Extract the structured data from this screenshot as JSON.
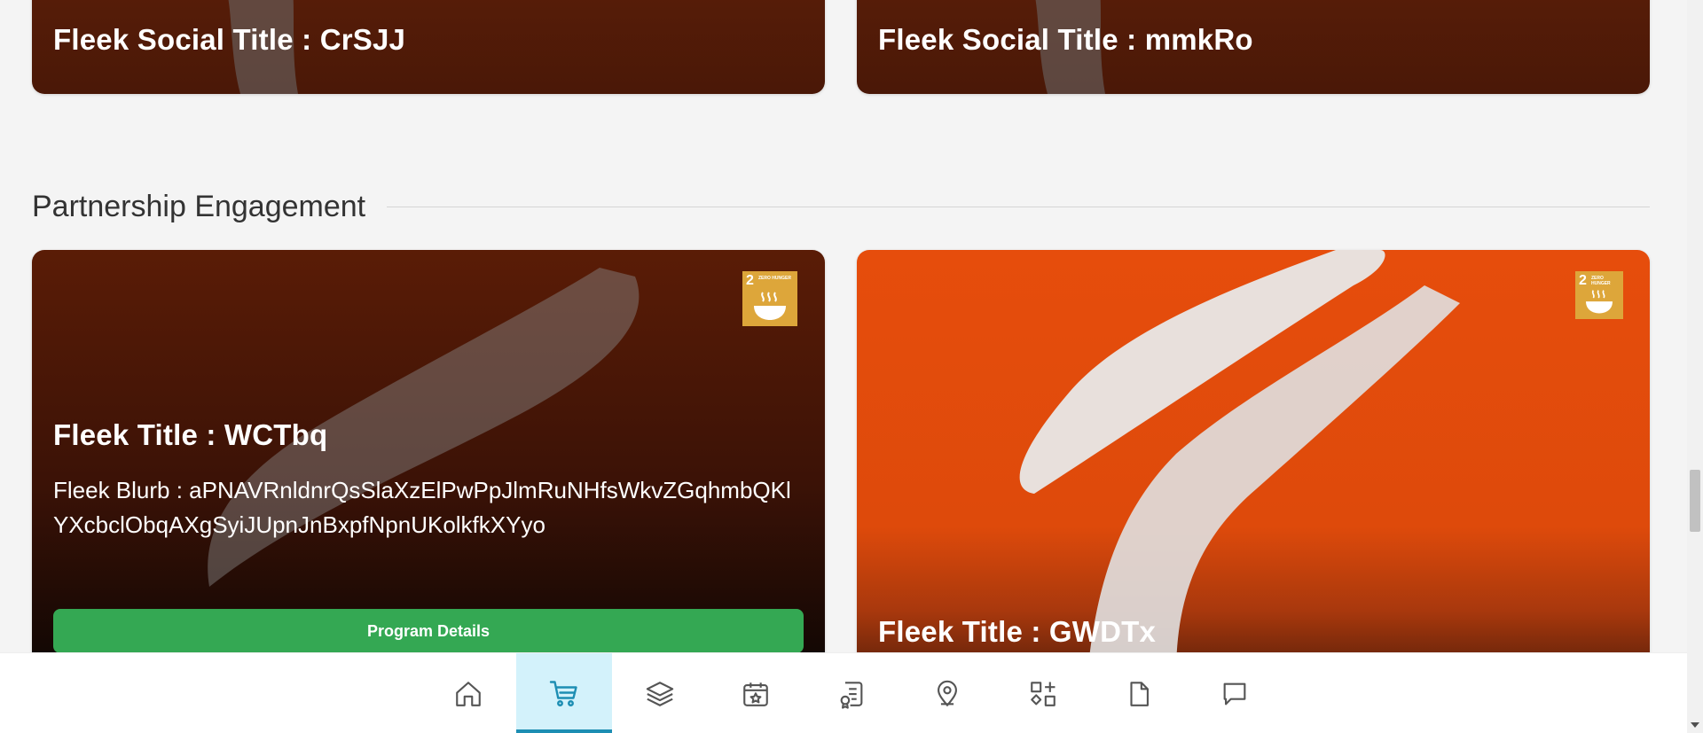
{
  "top_cards": [
    {
      "title": "Fleek Social Title : CrSJJ"
    },
    {
      "title": "Fleek Social Title : mmkRo"
    }
  ],
  "section": {
    "title": "Partnership Engagement"
  },
  "program_cards": [
    {
      "title": "Fleek Title : WCTbq",
      "blurb": "Fleek Blurb : aPNAVRnldnrQsSlaXzElPwPpJlmRuNHfsWkvZGqhmbQKlYXcbclObqAXgSyiJUpnJnBxpfNpnUKolkfkXYyo",
      "button_label": "Program Details",
      "badge": {
        "number": "2",
        "text": "ZERO HUNGER",
        "icon": "bowl-icon"
      }
    },
    {
      "title": "Fleek Title : GWDTx",
      "badge": {
        "number": "2",
        "text": "ZERO HUNGER",
        "icon": "bowl-icon"
      }
    }
  ],
  "bottom_nav": {
    "items": [
      {
        "name": "home",
        "icon": "home-icon",
        "active": false
      },
      {
        "name": "cart",
        "icon": "cart-icon",
        "active": true
      },
      {
        "name": "layers",
        "icon": "layers-icon",
        "active": false
      },
      {
        "name": "calendar",
        "icon": "calendar-star-icon",
        "active": false
      },
      {
        "name": "certificate",
        "icon": "certificate-icon",
        "active": false
      },
      {
        "name": "location",
        "icon": "map-pin-icon",
        "active": false
      },
      {
        "name": "apps",
        "icon": "shapes-icon",
        "active": false
      },
      {
        "name": "document",
        "icon": "document-icon",
        "active": false
      },
      {
        "name": "messages",
        "icon": "chat-icon",
        "active": false
      }
    ]
  },
  "colors": {
    "accent": "#1d8eb3",
    "active_tab_bg": "#d3f2fb",
    "button_green": "#34a853",
    "badge_gold": "#dda63a"
  }
}
